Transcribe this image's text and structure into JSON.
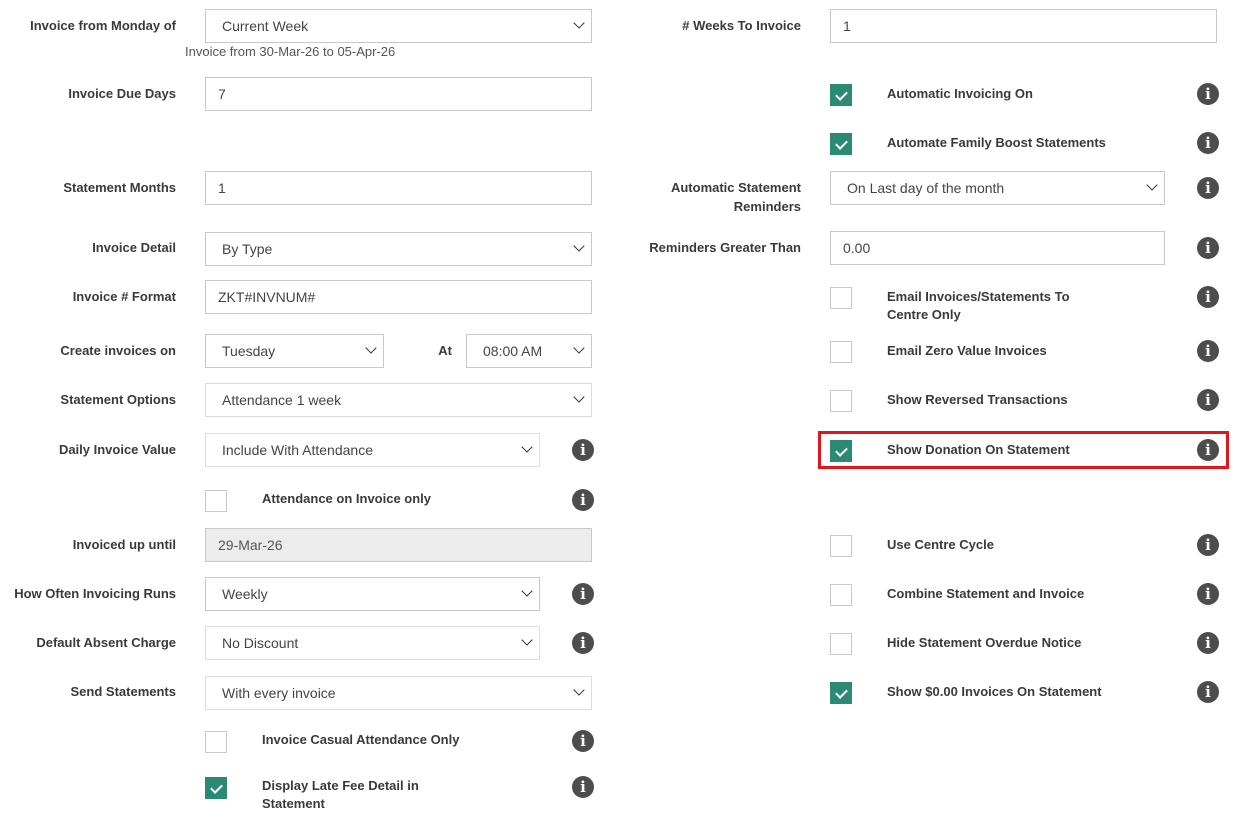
{
  "left": {
    "invoice_from_monday": {
      "label": "Invoice from Monday of",
      "value": "Current Week",
      "hint": "Invoice from 30-Mar-26 to 05-Apr-26"
    },
    "invoice_due_days": {
      "label": "Invoice Due Days",
      "value": "7"
    },
    "statement_months": {
      "label": "Statement Months",
      "value": "1"
    },
    "invoice_detail": {
      "label": "Invoice Detail",
      "value": "By Type"
    },
    "invoice_number_format": {
      "label": "Invoice # Format",
      "value": "ZKT#INVNUM#"
    },
    "create_invoices_on": {
      "label": "Create invoices on",
      "value": "Tuesday",
      "at_label": "At",
      "at_value": "08:00 AM"
    },
    "statement_options": {
      "label": "Statement Options",
      "value": "Attendance 1 week"
    },
    "daily_invoice_value": {
      "label": "Daily Invoice Value",
      "value": "Include With Attendance"
    },
    "attendance_on_invoice_only": {
      "label": "Attendance on Invoice only",
      "checked": false
    },
    "invoiced_up_until": {
      "label": "Invoiced up until",
      "value": "29-Mar-26"
    },
    "how_often_invoicing_runs": {
      "label": "How Often Invoicing Runs",
      "value": "Weekly"
    },
    "default_absent_charge": {
      "label": "Default Absent Charge",
      "value": "No Discount"
    },
    "send_statements": {
      "label": "Send Statements",
      "value": "With every invoice"
    },
    "invoice_casual_attendance_only": {
      "label": "Invoice Casual Attendance Only",
      "checked": false
    },
    "display_late_fee_detail": {
      "label_line1": "Display Late Fee Detail in",
      "label_line2": "Statement",
      "checked": true
    }
  },
  "right": {
    "weeks_to_invoice": {
      "label": "# Weeks To Invoice",
      "value": "1"
    },
    "automatic_invoicing_on": {
      "label": "Automatic Invoicing On",
      "checked": true
    },
    "automate_family_boost": {
      "label": "Automate Family Boost Statements",
      "checked": true
    },
    "automatic_statement_reminders": {
      "label_line1": "Automatic Statement",
      "label_line2": "Reminders",
      "value": "On Last day of the month"
    },
    "reminders_greater_than": {
      "label": "Reminders Greater Than",
      "value": "0.00"
    },
    "email_to_centre_only": {
      "label_line1": "Email Invoices/Statements To",
      "label_line2": "Centre Only",
      "checked": false
    },
    "email_zero_value_invoices": {
      "label": "Email Zero Value Invoices",
      "checked": false
    },
    "show_reversed_transactions": {
      "label": "Show Reversed Transactions",
      "checked": false
    },
    "show_donation_on_statement": {
      "label": "Show Donation On Statement",
      "checked": true
    },
    "use_centre_cycle": {
      "label": "Use Centre Cycle",
      "checked": false
    },
    "combine_statement_and_invoice": {
      "label": "Combine Statement and Invoice",
      "checked": false
    },
    "hide_statement_overdue_notice": {
      "label": "Hide Statement Overdue Notice",
      "checked": false
    },
    "show_zero_invoices_on_statement": {
      "label": "Show $0.00 Invoices On Statement",
      "checked": true
    }
  },
  "icons": {
    "info": "i"
  },
  "colors": {
    "accent": "#2a8a74",
    "highlight": "#e2141c",
    "info_icon": "#4d4d4d"
  }
}
